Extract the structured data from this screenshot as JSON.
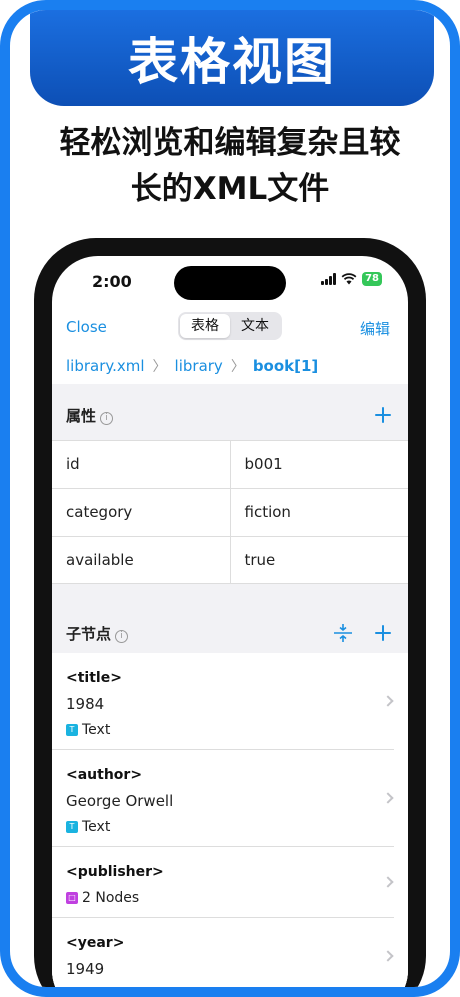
{
  "banner": {
    "title": "表格视图"
  },
  "subtitle": {
    "line1": "轻松浏览和编辑复杂且较",
    "line2": "长的XML文件"
  },
  "status": {
    "time": "2:00",
    "battery": "78"
  },
  "nav": {
    "close": "Close",
    "seg_table": "表格",
    "seg_text": "文本",
    "edit": "编辑"
  },
  "breadcrumb": [
    "library.xml",
    "library",
    "book[1]"
  ],
  "attributes": {
    "label": "属性",
    "rows": [
      {
        "name": "id",
        "value": "b001"
      },
      {
        "name": "category",
        "value": "fiction"
      },
      {
        "name": "available",
        "value": "true"
      }
    ]
  },
  "children": {
    "label": "子节点",
    "items": [
      {
        "tag": "<title>",
        "value": "1984",
        "type": "Text",
        "type_color": "#1ab3e0",
        "type_letter": "T"
      },
      {
        "tag": "<author>",
        "value": "George Orwell",
        "type": "Text",
        "type_color": "#1ab3e0",
        "type_letter": "T"
      },
      {
        "tag": "<publisher>",
        "value": "",
        "type": "2 Nodes",
        "type_color": "#c040e0",
        "type_letter": "□"
      },
      {
        "tag": "<year>",
        "value": "1949",
        "type": "",
        "type_color": "",
        "type_letter": ""
      }
    ]
  },
  "colors": {
    "accent": "#1a8fe0",
    "frame": "#1a7ff0",
    "battery": "#34c759"
  }
}
